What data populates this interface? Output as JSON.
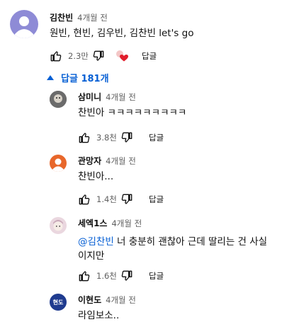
{
  "top_comment": {
    "author": "김찬빈",
    "time": "4개월 전",
    "text": "원빈, 현빈, 김우빈, 김찬빈 let's go",
    "likes": "2.3만",
    "reply_label": "답글"
  },
  "replies_toggle": {
    "label": "답글 181개"
  },
  "replies": [
    {
      "author": "삼미니",
      "time": "4개월 전",
      "text": "찬빈아 ㅋㅋㅋㅋㅋㅋㅋㅋㅋ",
      "likes": "3.8천",
      "reply_label": "답글"
    },
    {
      "author": "관망자",
      "time": "4개월 전",
      "text": "찬빈아...",
      "likes": "1.4천",
      "reply_label": "답글"
    },
    {
      "author": "세엑1스",
      "time": "4개월 전",
      "mention": "@김찬빈",
      "text": " 너 충분히 괜찮아 근데 딸리는 건 사실이지만",
      "likes": "1.6천",
      "reply_label": "답글"
    },
    {
      "author": "이현도",
      "time": "4개월 전",
      "text": "라임보소..",
      "avatar_text": "현도"
    }
  ],
  "colors": {
    "link": "#065fd4",
    "secondary": "#606060",
    "avatar_purple": "#8e8bd6",
    "avatar_orange": "#e8672b",
    "avatar_navy": "#1f3b8f",
    "heart": "#e11d2b"
  }
}
